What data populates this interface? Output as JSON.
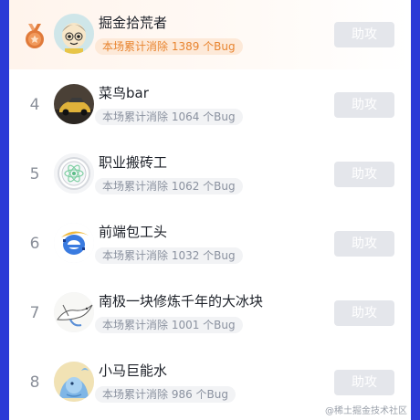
{
  "help_label": "助攻",
  "watermark": "@稀土掘金技术社区",
  "colors": {
    "background_blue": "#2b3ad6",
    "bronze_medal": "#e07a3a",
    "highlight_text": "#e8842f",
    "button_gray": "#e4e6eb"
  },
  "rows": [
    {
      "rank": "",
      "medal": "bronze-medal-icon",
      "name": "掘金拾荒者",
      "stat": "本场累计消除 1389 个Bug",
      "avatar": "cartoon-boy-avatar"
    },
    {
      "rank": "4",
      "name": "菜鸟bar",
      "stat": "本场累计消除 1064 个Bug",
      "avatar": "car-photo-avatar"
    },
    {
      "rank": "5",
      "name": "职业搬砖工",
      "stat": "本场累计消除 1062 个Bug",
      "avatar": "atom-logo-avatar"
    },
    {
      "rank": "6",
      "name": "前端包工头",
      "stat": "本场累计消除 1032 个Bug",
      "avatar": "ie-pixel-avatar"
    },
    {
      "rank": "7",
      "name": "南极一块修炼千年的大冰块",
      "stat": "本场累计消除 1001 个Bug",
      "avatar": "bird-sketch-avatar"
    },
    {
      "rank": "8",
      "name": "小马巨能水",
      "stat": "本场累计消除 986 个Bug",
      "avatar": "blue-creature-avatar"
    }
  ]
}
